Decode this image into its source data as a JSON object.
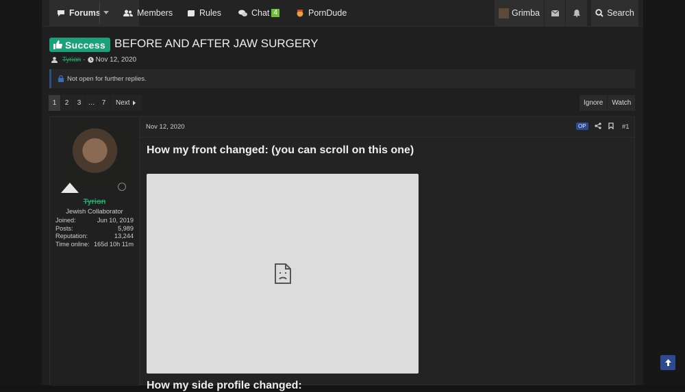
{
  "nav": {
    "forums": "Forums",
    "members": "Members",
    "rules": "Rules",
    "chat": "Chat",
    "chat_badge": "4",
    "porndude": "PornDude",
    "username": "Grimba",
    "search": "Search"
  },
  "thread": {
    "prefix": "Success",
    "title": "BEFORE AND AFTER JAW SURGERY",
    "author": "Tyrion",
    "date": "Nov 12, 2020",
    "notice": "Not open for further replies."
  },
  "pagination": {
    "pages": [
      "1",
      "2",
      "3",
      "…",
      "7"
    ],
    "next": "Next",
    "ignore": "Ignore",
    "watch": "Watch"
  },
  "post": {
    "user": {
      "name": "Tyrion",
      "title": "Jewish Collaborator",
      "stats": [
        {
          "label": "Joined:",
          "value": "Jun 10, 2019"
        },
        {
          "label": "Posts:",
          "value": "5,989"
        },
        {
          "label": "Reputation:",
          "value": "13,244"
        },
        {
          "label": "Time online:",
          "value": "165d 10h 11m"
        }
      ]
    },
    "date": "Nov 12, 2020",
    "op": "OP",
    "number": "#1",
    "heading1": "How my front changed: (you can scroll on this one)",
    "heading2": "How my side profile changed:"
  },
  "colors": {
    "accent_green": "#1aa179",
    "username_green": "#22a86b",
    "op_blue": "#2d4a90",
    "background": "#1f1f1f"
  }
}
